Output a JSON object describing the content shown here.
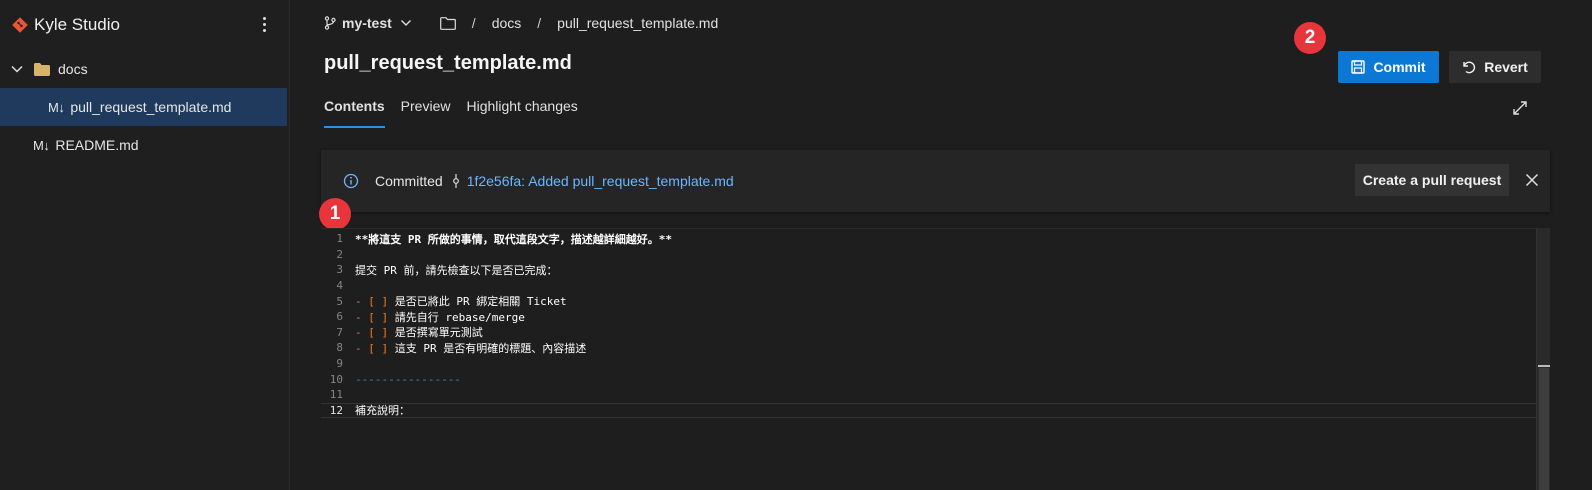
{
  "sidebar": {
    "title": "Kyle Studio",
    "folder": {
      "label": "docs",
      "items": [
        {
          "icon": "M↓",
          "label": "pull_request_template.md"
        }
      ]
    },
    "root_items": [
      {
        "icon": "M↓",
        "label": "README.md"
      }
    ]
  },
  "breadcrumb": {
    "branch": "my-test",
    "sep": "/",
    "parts": [
      "docs",
      "pull_request_template.md"
    ]
  },
  "page_title": "pull_request_template.md",
  "tabs": [
    "Contents",
    "Preview",
    "Highlight changes"
  ],
  "actions": {
    "commit": "Commit",
    "revert": "Revert"
  },
  "badges": [
    "1",
    "2"
  ],
  "notice": {
    "text": "Committed",
    "link": "1f2e56fa: Added pull_request_template.md",
    "button": "Create a pull request"
  },
  "editor": {
    "lines": [
      {
        "n": "1",
        "text": "**將這支 PR 所做的事情，取代這段文字，描述越詳細越好。**"
      },
      {
        "n": "2",
        "text": ""
      },
      {
        "n": "3",
        "text": "提交 PR 前，請先檢查以下是否已完成："
      },
      {
        "n": "4",
        "text": ""
      },
      {
        "n": "5",
        "dash": "-",
        "box": "[ ]",
        "text": "是否已將此 PR 綁定相關 Ticket"
      },
      {
        "n": "6",
        "dash": "-",
        "box": "[ ]",
        "text": "請先自行 rebase/merge"
      },
      {
        "n": "7",
        "dash": "-",
        "box": "[ ]",
        "text": "是否撰寫單元測試"
      },
      {
        "n": "8",
        "dash": "-",
        "box": "[ ]",
        "text": "這支 PR 是否有明確的標題、內容描述"
      },
      {
        "n": "9",
        "text": ""
      },
      {
        "n": "10",
        "text": "----------------"
      },
      {
        "n": "11",
        "text": ""
      },
      {
        "n": "12",
        "text": "補充說明："
      }
    ]
  },
  "colors": {
    "accent": "#0a78d4",
    "badge": "#e8343b",
    "link": "#6cb6ff",
    "selected": "#1f3a5c"
  }
}
